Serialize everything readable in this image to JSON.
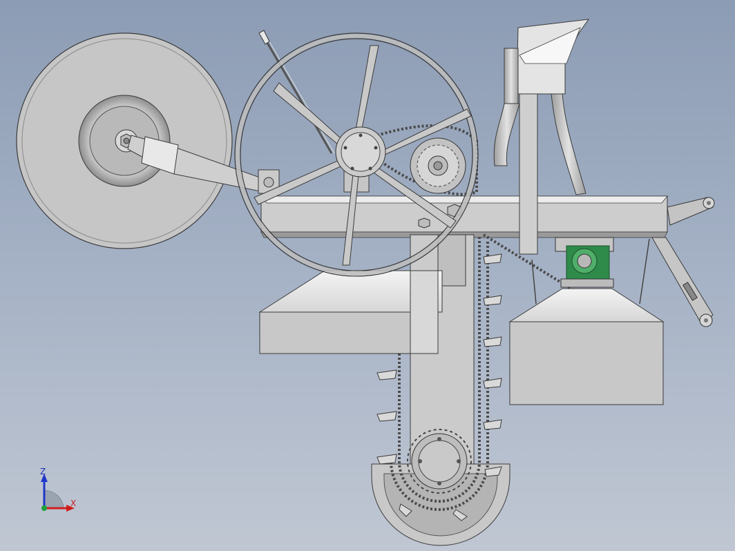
{
  "triad": {
    "z_label": "Z",
    "x_label": "X",
    "colors": {
      "z": "#1f36c8",
      "x": "#d01e1e",
      "y": "#1fa03a"
    }
  },
  "viewport": {
    "background_top": "#8c9cb4",
    "background_bottom": "#c0c7d3"
  },
  "model": {
    "colors": {
      "steel": "#c9c9c9",
      "steel_light": "#e4e4e4",
      "steel_dark": "#a9a9a9",
      "edge": "#3a3a3a",
      "bearing_green": "#2e8b4a"
    }
  }
}
